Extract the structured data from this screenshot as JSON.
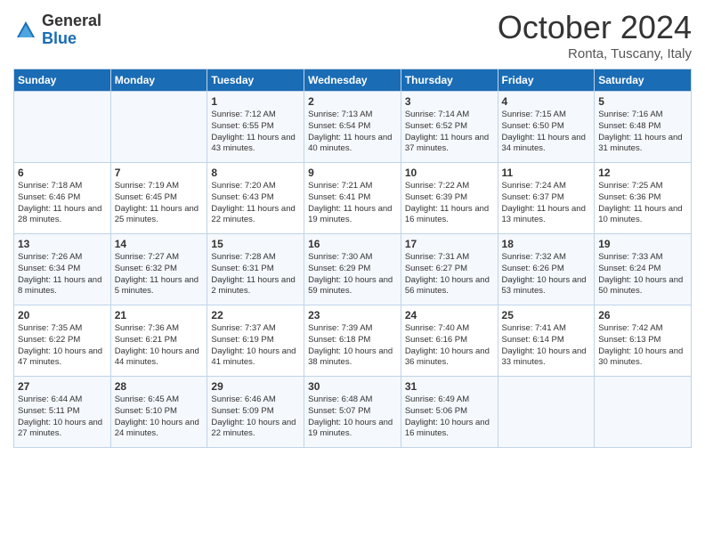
{
  "logo": {
    "general": "General",
    "blue": "Blue"
  },
  "header": {
    "month": "October 2024",
    "location": "Ronta, Tuscany, Italy"
  },
  "weekdays": [
    "Sunday",
    "Monday",
    "Tuesday",
    "Wednesday",
    "Thursday",
    "Friday",
    "Saturday"
  ],
  "weeks": [
    [
      {
        "day": "",
        "sunrise": "",
        "sunset": "",
        "daylight": ""
      },
      {
        "day": "",
        "sunrise": "",
        "sunset": "",
        "daylight": ""
      },
      {
        "day": "1",
        "sunrise": "Sunrise: 7:12 AM",
        "sunset": "Sunset: 6:55 PM",
        "daylight": "Daylight: 11 hours and 43 minutes."
      },
      {
        "day": "2",
        "sunrise": "Sunrise: 7:13 AM",
        "sunset": "Sunset: 6:54 PM",
        "daylight": "Daylight: 11 hours and 40 minutes."
      },
      {
        "day": "3",
        "sunrise": "Sunrise: 7:14 AM",
        "sunset": "Sunset: 6:52 PM",
        "daylight": "Daylight: 11 hours and 37 minutes."
      },
      {
        "day": "4",
        "sunrise": "Sunrise: 7:15 AM",
        "sunset": "Sunset: 6:50 PM",
        "daylight": "Daylight: 11 hours and 34 minutes."
      },
      {
        "day": "5",
        "sunrise": "Sunrise: 7:16 AM",
        "sunset": "Sunset: 6:48 PM",
        "daylight": "Daylight: 11 hours and 31 minutes."
      }
    ],
    [
      {
        "day": "6",
        "sunrise": "Sunrise: 7:18 AM",
        "sunset": "Sunset: 6:46 PM",
        "daylight": "Daylight: 11 hours and 28 minutes."
      },
      {
        "day": "7",
        "sunrise": "Sunrise: 7:19 AM",
        "sunset": "Sunset: 6:45 PM",
        "daylight": "Daylight: 11 hours and 25 minutes."
      },
      {
        "day": "8",
        "sunrise": "Sunrise: 7:20 AM",
        "sunset": "Sunset: 6:43 PM",
        "daylight": "Daylight: 11 hours and 22 minutes."
      },
      {
        "day": "9",
        "sunrise": "Sunrise: 7:21 AM",
        "sunset": "Sunset: 6:41 PM",
        "daylight": "Daylight: 11 hours and 19 minutes."
      },
      {
        "day": "10",
        "sunrise": "Sunrise: 7:22 AM",
        "sunset": "Sunset: 6:39 PM",
        "daylight": "Daylight: 11 hours and 16 minutes."
      },
      {
        "day": "11",
        "sunrise": "Sunrise: 7:24 AM",
        "sunset": "Sunset: 6:37 PM",
        "daylight": "Daylight: 11 hours and 13 minutes."
      },
      {
        "day": "12",
        "sunrise": "Sunrise: 7:25 AM",
        "sunset": "Sunset: 6:36 PM",
        "daylight": "Daylight: 11 hours and 10 minutes."
      }
    ],
    [
      {
        "day": "13",
        "sunrise": "Sunrise: 7:26 AM",
        "sunset": "Sunset: 6:34 PM",
        "daylight": "Daylight: 11 hours and 8 minutes."
      },
      {
        "day": "14",
        "sunrise": "Sunrise: 7:27 AM",
        "sunset": "Sunset: 6:32 PM",
        "daylight": "Daylight: 11 hours and 5 minutes."
      },
      {
        "day": "15",
        "sunrise": "Sunrise: 7:28 AM",
        "sunset": "Sunset: 6:31 PM",
        "daylight": "Daylight: 11 hours and 2 minutes."
      },
      {
        "day": "16",
        "sunrise": "Sunrise: 7:30 AM",
        "sunset": "Sunset: 6:29 PM",
        "daylight": "Daylight: 10 hours and 59 minutes."
      },
      {
        "day": "17",
        "sunrise": "Sunrise: 7:31 AM",
        "sunset": "Sunset: 6:27 PM",
        "daylight": "Daylight: 10 hours and 56 minutes."
      },
      {
        "day": "18",
        "sunrise": "Sunrise: 7:32 AM",
        "sunset": "Sunset: 6:26 PM",
        "daylight": "Daylight: 10 hours and 53 minutes."
      },
      {
        "day": "19",
        "sunrise": "Sunrise: 7:33 AM",
        "sunset": "Sunset: 6:24 PM",
        "daylight": "Daylight: 10 hours and 50 minutes."
      }
    ],
    [
      {
        "day": "20",
        "sunrise": "Sunrise: 7:35 AM",
        "sunset": "Sunset: 6:22 PM",
        "daylight": "Daylight: 10 hours and 47 minutes."
      },
      {
        "day": "21",
        "sunrise": "Sunrise: 7:36 AM",
        "sunset": "Sunset: 6:21 PM",
        "daylight": "Daylight: 10 hours and 44 minutes."
      },
      {
        "day": "22",
        "sunrise": "Sunrise: 7:37 AM",
        "sunset": "Sunset: 6:19 PM",
        "daylight": "Daylight: 10 hours and 41 minutes."
      },
      {
        "day": "23",
        "sunrise": "Sunrise: 7:39 AM",
        "sunset": "Sunset: 6:18 PM",
        "daylight": "Daylight: 10 hours and 38 minutes."
      },
      {
        "day": "24",
        "sunrise": "Sunrise: 7:40 AM",
        "sunset": "Sunset: 6:16 PM",
        "daylight": "Daylight: 10 hours and 36 minutes."
      },
      {
        "day": "25",
        "sunrise": "Sunrise: 7:41 AM",
        "sunset": "Sunset: 6:14 PM",
        "daylight": "Daylight: 10 hours and 33 minutes."
      },
      {
        "day": "26",
        "sunrise": "Sunrise: 7:42 AM",
        "sunset": "Sunset: 6:13 PM",
        "daylight": "Daylight: 10 hours and 30 minutes."
      }
    ],
    [
      {
        "day": "27",
        "sunrise": "Sunrise: 6:44 AM",
        "sunset": "Sunset: 5:11 PM",
        "daylight": "Daylight: 10 hours and 27 minutes."
      },
      {
        "day": "28",
        "sunrise": "Sunrise: 6:45 AM",
        "sunset": "Sunset: 5:10 PM",
        "daylight": "Daylight: 10 hours and 24 minutes."
      },
      {
        "day": "29",
        "sunrise": "Sunrise: 6:46 AM",
        "sunset": "Sunset: 5:09 PM",
        "daylight": "Daylight: 10 hours and 22 minutes."
      },
      {
        "day": "30",
        "sunrise": "Sunrise: 6:48 AM",
        "sunset": "Sunset: 5:07 PM",
        "daylight": "Daylight: 10 hours and 19 minutes."
      },
      {
        "day": "31",
        "sunrise": "Sunrise: 6:49 AM",
        "sunset": "Sunset: 5:06 PM",
        "daylight": "Daylight: 10 hours and 16 minutes."
      },
      {
        "day": "",
        "sunrise": "",
        "sunset": "",
        "daylight": ""
      },
      {
        "day": "",
        "sunrise": "",
        "sunset": "",
        "daylight": ""
      }
    ]
  ]
}
